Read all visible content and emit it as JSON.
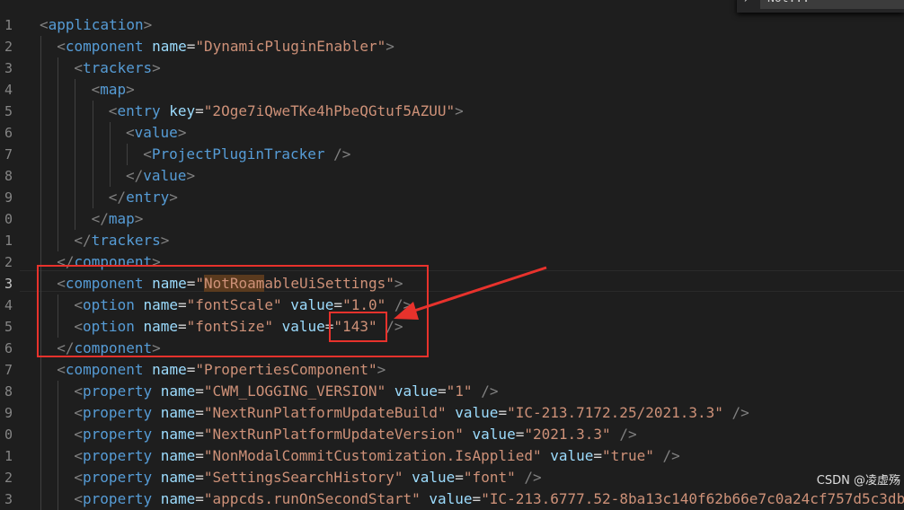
{
  "editor": {
    "line_numbers": [
      "1",
      "2",
      "3",
      "4",
      "5",
      "6",
      "7",
      "8",
      "9",
      "0",
      "1",
      "2",
      "3",
      "4",
      "5",
      "6",
      "7",
      "8",
      "9",
      "0",
      "1",
      "2",
      "3"
    ],
    "lines": [
      {
        "tokens": [
          [
            "p",
            "<"
          ],
          [
            "t",
            "application"
          ],
          [
            "p",
            ">"
          ]
        ]
      },
      {
        "tokens": [
          [
            "p",
            "<"
          ],
          [
            "t",
            "component"
          ],
          [
            "e",
            " "
          ],
          [
            "a",
            "name"
          ],
          [
            "e",
            "="
          ],
          [
            "s",
            "\"DynamicPluginEnabler\""
          ],
          [
            "p",
            ">"
          ]
        ]
      },
      {
        "tokens": [
          [
            "p",
            "<"
          ],
          [
            "t",
            "trackers"
          ],
          [
            "p",
            ">"
          ]
        ]
      },
      {
        "tokens": [
          [
            "p",
            "<"
          ],
          [
            "t",
            "map"
          ],
          [
            "p",
            ">"
          ]
        ]
      },
      {
        "tokens": [
          [
            "p",
            "<"
          ],
          [
            "t",
            "entry"
          ],
          [
            "e",
            " "
          ],
          [
            "a",
            "key"
          ],
          [
            "e",
            "="
          ],
          [
            "s",
            "\"2Oge7iQweTKe4hPbeQGtuf5AZUU\""
          ],
          [
            "p",
            ">"
          ]
        ]
      },
      {
        "tokens": [
          [
            "p",
            "<"
          ],
          [
            "t",
            "value"
          ],
          [
            "p",
            ">"
          ]
        ]
      },
      {
        "tokens": [
          [
            "p",
            "<"
          ],
          [
            "t",
            "ProjectPluginTracker"
          ],
          [
            "e",
            " "
          ],
          [
            "p",
            "/>"
          ]
        ]
      },
      {
        "tokens": [
          [
            "p",
            "</"
          ],
          [
            "t",
            "value"
          ],
          [
            "p",
            ">"
          ]
        ]
      },
      {
        "tokens": [
          [
            "p",
            "</"
          ],
          [
            "t",
            "entry"
          ],
          [
            "p",
            ">"
          ]
        ]
      },
      {
        "tokens": [
          [
            "p",
            "</"
          ],
          [
            "t",
            "map"
          ],
          [
            "p",
            ">"
          ]
        ]
      },
      {
        "tokens": [
          [
            "p",
            "</"
          ],
          [
            "t",
            "trackers"
          ],
          [
            "p",
            ">"
          ]
        ]
      },
      {
        "tokens": [
          [
            "p",
            "</"
          ],
          [
            "t",
            "component"
          ],
          [
            "p",
            ">"
          ]
        ]
      },
      {
        "tokens": [
          [
            "p",
            "<"
          ],
          [
            "t",
            "component"
          ],
          [
            "e",
            " "
          ],
          [
            "a",
            "name"
          ],
          [
            "e",
            "="
          ],
          [
            "s",
            "\""
          ],
          [
            "s",
            "NotRoam"
          ],
          [
            "s",
            "ableUiSettings"
          ],
          [
            "s",
            "\""
          ],
          [
            "p",
            ">"
          ]
        ]
      },
      {
        "tokens": [
          [
            "p",
            "<"
          ],
          [
            "t",
            "option"
          ],
          [
            "e",
            " "
          ],
          [
            "a",
            "name"
          ],
          [
            "e",
            "="
          ],
          [
            "s",
            "\"fontScale\""
          ],
          [
            "e",
            " "
          ],
          [
            "a",
            "value"
          ],
          [
            "e",
            "="
          ],
          [
            "s",
            "\"1.0\""
          ],
          [
            "e",
            " "
          ],
          [
            "p",
            "/>"
          ]
        ]
      },
      {
        "tokens": [
          [
            "p",
            "<"
          ],
          [
            "t",
            "option"
          ],
          [
            "e",
            " "
          ],
          [
            "a",
            "name"
          ],
          [
            "e",
            "="
          ],
          [
            "s",
            "\"fontSize\""
          ],
          [
            "e",
            " "
          ],
          [
            "a",
            "value"
          ],
          [
            "e",
            "="
          ],
          [
            "s",
            "\"143\""
          ],
          [
            "e",
            " "
          ],
          [
            "p",
            "/>"
          ]
        ]
      },
      {
        "tokens": [
          [
            "p",
            "</"
          ],
          [
            "t",
            "component"
          ],
          [
            "p",
            ">"
          ]
        ]
      },
      {
        "tokens": [
          [
            "p",
            "<"
          ],
          [
            "t",
            "component"
          ],
          [
            "e",
            " "
          ],
          [
            "a",
            "name"
          ],
          [
            "e",
            "="
          ],
          [
            "s",
            "\"PropertiesComponent\""
          ],
          [
            "p",
            ">"
          ]
        ]
      },
      {
        "tokens": [
          [
            "p",
            "<"
          ],
          [
            "t",
            "property"
          ],
          [
            "e",
            " "
          ],
          [
            "a",
            "name"
          ],
          [
            "e",
            "="
          ],
          [
            "s",
            "\"CWM_LOGGING_VERSION\""
          ],
          [
            "e",
            " "
          ],
          [
            "a",
            "value"
          ],
          [
            "e",
            "="
          ],
          [
            "s",
            "\"1\""
          ],
          [
            "e",
            " "
          ],
          [
            "p",
            "/>"
          ]
        ]
      },
      {
        "tokens": [
          [
            "p",
            "<"
          ],
          [
            "t",
            "property"
          ],
          [
            "e",
            " "
          ],
          [
            "a",
            "name"
          ],
          [
            "e",
            "="
          ],
          [
            "s",
            "\"NextRunPlatformUpdateBuild\""
          ],
          [
            "e",
            " "
          ],
          [
            "a",
            "value"
          ],
          [
            "e",
            "="
          ],
          [
            "s",
            "\"IC-213.7172.25/2021.3.3\""
          ],
          [
            "e",
            " "
          ],
          [
            "p",
            "/>"
          ]
        ]
      },
      {
        "tokens": [
          [
            "p",
            "<"
          ],
          [
            "t",
            "property"
          ],
          [
            "e",
            " "
          ],
          [
            "a",
            "name"
          ],
          [
            "e",
            "="
          ],
          [
            "s",
            "\"NextRunPlatformUpdateVersion\""
          ],
          [
            "e",
            " "
          ],
          [
            "a",
            "value"
          ],
          [
            "e",
            "="
          ],
          [
            "s",
            "\"2021.3.3\""
          ],
          [
            "e",
            " "
          ],
          [
            "p",
            "/>"
          ]
        ]
      },
      {
        "tokens": [
          [
            "p",
            "<"
          ],
          [
            "t",
            "property"
          ],
          [
            "e",
            " "
          ],
          [
            "a",
            "name"
          ],
          [
            "e",
            "="
          ],
          [
            "s",
            "\"NonModalCommitCustomization.IsApplied\""
          ],
          [
            "e",
            " "
          ],
          [
            "a",
            "value"
          ],
          [
            "e",
            "="
          ],
          [
            "s",
            "\"true\""
          ],
          [
            "e",
            " "
          ],
          [
            "p",
            "/>"
          ]
        ]
      },
      {
        "tokens": [
          [
            "p",
            "<"
          ],
          [
            "t",
            "property"
          ],
          [
            "e",
            " "
          ],
          [
            "a",
            "name"
          ],
          [
            "e",
            "="
          ],
          [
            "s",
            "\"SettingsSearchHistory\""
          ],
          [
            "e",
            " "
          ],
          [
            "a",
            "value"
          ],
          [
            "e",
            "="
          ],
          [
            "s",
            "\"font\""
          ],
          [
            "e",
            " "
          ],
          [
            "p",
            "/>"
          ]
        ]
      },
      {
        "tokens": [
          [
            "p",
            "<"
          ],
          [
            "t",
            "property"
          ],
          [
            "e",
            " "
          ],
          [
            "a",
            "name"
          ],
          [
            "e",
            "="
          ],
          [
            "s",
            "\"appcds.runOnSecondStart\""
          ],
          [
            "e",
            " "
          ],
          [
            "a",
            "value"
          ],
          [
            "e",
            "="
          ],
          [
            "s",
            "\"IC-213.6777.52-8ba13c140f62b66e7c0a24cf757d5c3db\""
          ]
        ]
      }
    ],
    "indent_levels": [
      0,
      1,
      2,
      3,
      4,
      5,
      6,
      5,
      4,
      3,
      2,
      1,
      1,
      2,
      2,
      1,
      1,
      2,
      2,
      2,
      2,
      2,
      2
    ],
    "active_line_index": 12,
    "highlight_line_index": 12,
    "highlight_token_index": 6
  },
  "find_widget": {
    "chevron": "›",
    "query": "Not..."
  },
  "watermark": "CSDN @凌虚殇",
  "colors": {
    "annotation": "#e8322c",
    "background": "#1e1e1e",
    "tag": "#569cd6",
    "attribute": "#9cdcfe",
    "string": "#ce9178"
  }
}
